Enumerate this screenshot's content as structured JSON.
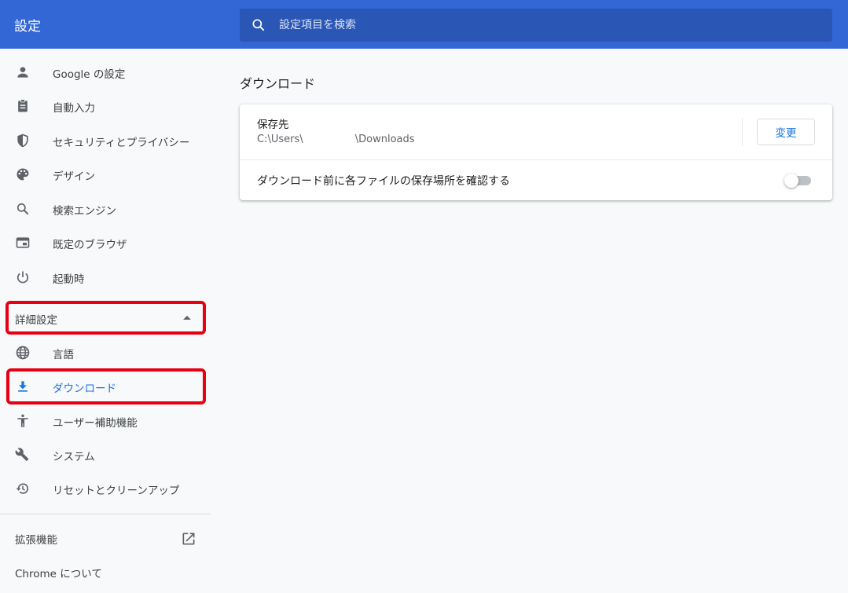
{
  "header": {
    "title": "設定",
    "search_placeholder": "設定項目を検索"
  },
  "sidebar": {
    "items": [
      {
        "label": "Google の設定",
        "icon": "person-icon"
      },
      {
        "label": "自動入力",
        "icon": "clipboard-icon"
      },
      {
        "label": "セキュリティとプライバシー",
        "icon": "shield-icon"
      },
      {
        "label": "デザイン",
        "icon": "palette-icon"
      },
      {
        "label": "検索エンジン",
        "icon": "search-icon"
      },
      {
        "label": "既定のブラウザ",
        "icon": "browser-icon"
      },
      {
        "label": "起動時",
        "icon": "power-icon"
      }
    ],
    "advanced": {
      "label": "詳細設定",
      "expanded": true,
      "items": [
        {
          "label": "言語",
          "icon": "globe-icon"
        },
        {
          "label": "ダウンロード",
          "icon": "download-icon",
          "active": true
        },
        {
          "label": "ユーザー補助機能",
          "icon": "accessibility-icon"
        },
        {
          "label": "システム",
          "icon": "wrench-icon"
        },
        {
          "label": "リセットとクリーンアップ",
          "icon": "restore-icon"
        }
      ]
    },
    "extensions_label": "拡張機能",
    "about_label": "Chrome について"
  },
  "main": {
    "section_title": "ダウンロード",
    "location_label": "保存先",
    "location_path": "C:\\Users\\                \\Downloads",
    "change_button": "変更",
    "ask_label": "ダウンロード前に各ファイルの保存場所を確認する",
    "ask_toggle_on": false
  },
  "colors": {
    "header_blue": "#3367d6",
    "active_blue": "#1a73e8",
    "highlight_red": "#e60012"
  }
}
